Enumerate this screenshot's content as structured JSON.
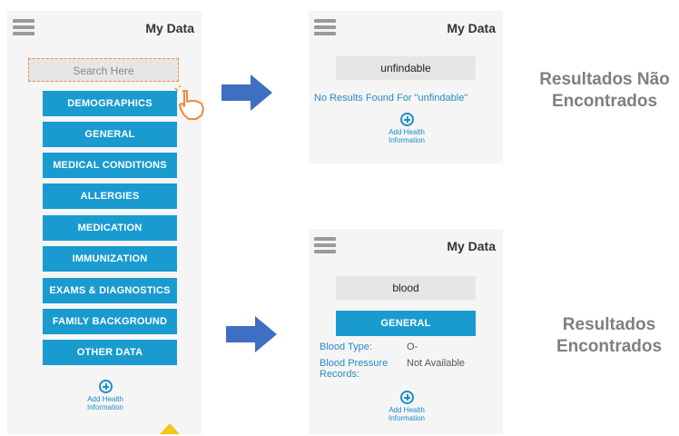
{
  "left_screen": {
    "title": "My Data",
    "search_placeholder": "Search Here",
    "menu": [
      "DEMOGRAPHICS",
      "GENERAL",
      "MEDICAL CONDITIONS",
      "ALLERGIES",
      "MEDICATION",
      "IMMUNIZATION",
      "EXAMS & DIAGNOSTICS",
      "FAMILY BACKGROUND",
      "OTHER DATA"
    ],
    "add_label_1": "Add Health",
    "add_label_2": "Information"
  },
  "top_screen": {
    "title": "My Data",
    "search_value": "unfindable",
    "no_results": "No Results Found For \"unfindable\"",
    "add_label_1": "Add Health",
    "add_label_2": "Information"
  },
  "bottom_screen": {
    "title": "My Data",
    "search_value": "blood",
    "section_button": "GENERAL",
    "blood_type_label": "Blood Type:",
    "blood_type_value": "O-",
    "blood_pressure_label_1": "Blood Pressure",
    "blood_pressure_label_2": "Records:",
    "blood_pressure_value": "Not Available",
    "add_label_1": "Add Health",
    "add_label_2": "Information"
  },
  "labels": {
    "not_found_1": "Resultados Não",
    "not_found_2": "Encontrados",
    "found_1": "Resultados",
    "found_2": "Encontrados"
  },
  "colors": {
    "primary_blue": "#1a9bd0",
    "arrow_blue": "#3f6fc2",
    "highlight_orange": "#f08a3c"
  }
}
